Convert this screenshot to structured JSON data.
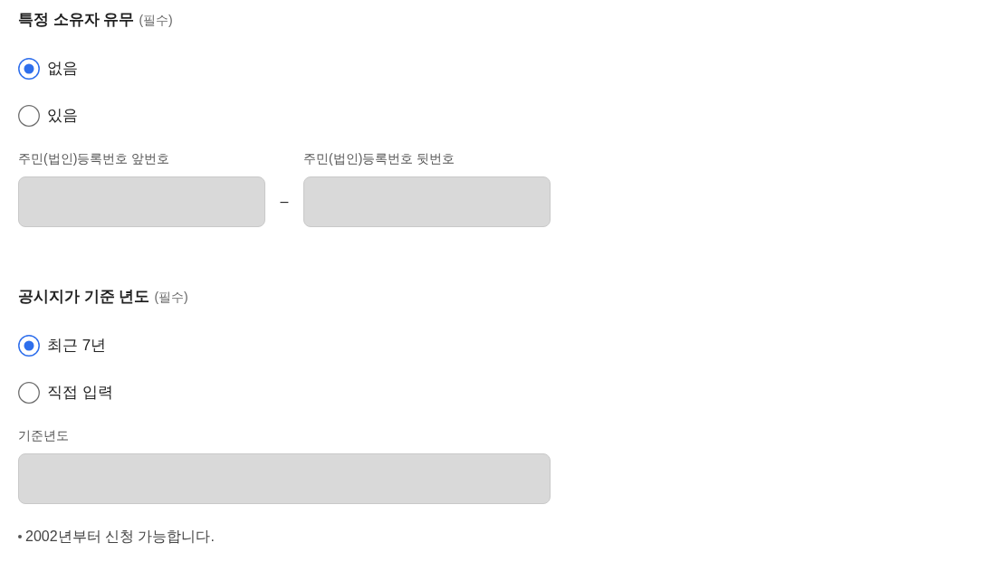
{
  "sections": [
    {
      "title": "특정 소유자 유무",
      "required_label": "(필수)",
      "options": [
        {
          "label": "없음",
          "selected": true
        },
        {
          "label": "있음",
          "selected": false
        }
      ],
      "fields": [
        {
          "label": "주민(법인)등록번호 앞번호",
          "disabled": true
        },
        {
          "label": "주민(법인)등록번호 뒷번호",
          "disabled": true
        }
      ],
      "separator": "–"
    },
    {
      "title": "공시지가 기준 년도",
      "required_label": "(필수)",
      "options": [
        {
          "label": "최근 7년",
          "selected": true
        },
        {
          "label": "직접 입력",
          "selected": false
        }
      ],
      "fields": [
        {
          "label": "기준년도",
          "disabled": true
        }
      ],
      "note": "2002년부터 신청 가능합니다."
    }
  ]
}
